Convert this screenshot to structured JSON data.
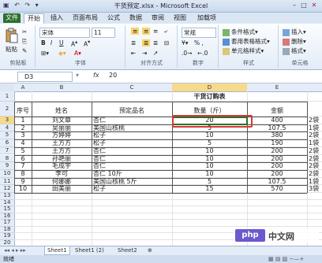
{
  "window": {
    "title": "干货预定.xlsx - Microsoft Excel",
    "quick_access": "▣ ↶ ↷ ▾",
    "min": "–",
    "max": "□",
    "close": "✕"
  },
  "ribbon_tabs": [
    "文件",
    "开始",
    "插入",
    "页面布局",
    "公式",
    "数据",
    "审阅",
    "视图",
    "加载项"
  ],
  "ribbon": {
    "paste_label": "粘贴",
    "clipboard_label": "剪贴板",
    "font_name": "宋体",
    "font_size": "11",
    "font_group_label": "字体",
    "bold": "B",
    "italic": "I",
    "underline": "U",
    "align_group_label": "对齐方式",
    "number_format": "常规",
    "number_symbols": "% ,",
    "number_group_label": "数字",
    "cond_format": "条件格式",
    "table_format": "套用表格格式",
    "cell_styles": "单元格样式",
    "styles_group_label": "样式",
    "insert": "插入",
    "delete": "删除",
    "format": "格式",
    "cells_group_label": "单元格"
  },
  "formula_bar": {
    "name_box": "D3",
    "fx": "fx",
    "value": "20"
  },
  "columns": [
    "A",
    "B",
    "C",
    "D",
    "E"
  ],
  "rows": [
    "1",
    "2",
    "3",
    "4",
    "5",
    "6",
    "7",
    "8",
    "9",
    "10",
    "11",
    "12",
    "13",
    "14",
    "15",
    "16",
    "17",
    "18",
    "19",
    "20",
    "21",
    "22"
  ],
  "table": {
    "title": "干货订购表",
    "headers": [
      "序号",
      "姓名",
      "预定品名",
      "数量（斤）",
      "金额"
    ],
    "data": [
      [
        "1",
        "刘文章",
        "杏仁",
        "20",
        "400",
        "2袋"
      ],
      [
        "2",
        "吴丽丽",
        "美国山核桃",
        "5",
        "107.5",
        "1袋"
      ],
      [
        "3",
        "方婷婷",
        "松子",
        "10",
        "380",
        "2袋"
      ],
      [
        "4",
        "王方方",
        "松子",
        "5",
        "190",
        "1袋"
      ],
      [
        "5",
        "王方方",
        "杏仁",
        "10",
        "200",
        "2袋"
      ],
      [
        "6",
        "孙艳丽",
        "杏仁",
        "10",
        "200",
        "2袋"
      ],
      [
        "7",
        "毛成宇",
        "杏仁",
        "10",
        "200",
        "2袋"
      ],
      [
        "8",
        "李可",
        "杏仁    10斤",
        "10",
        "200",
        "2袋"
      ],
      [
        "9",
        "何娜娜",
        "美国山核桃    5斤",
        "5",
        "107.5",
        "1袋"
      ],
      [
        "10",
        "田美丽",
        "松子",
        "15",
        "570",
        "3袋"
      ]
    ]
  },
  "sheets": [
    "Sheet1",
    "Sheet1 (2)",
    "Sheet2"
  ],
  "status": "就绪",
  "watermark": {
    "logo": "php",
    "text": "中文网"
  },
  "colors": {
    "accent_green": "#2a6f2a",
    "highlight_red": "#d23a3a"
  }
}
